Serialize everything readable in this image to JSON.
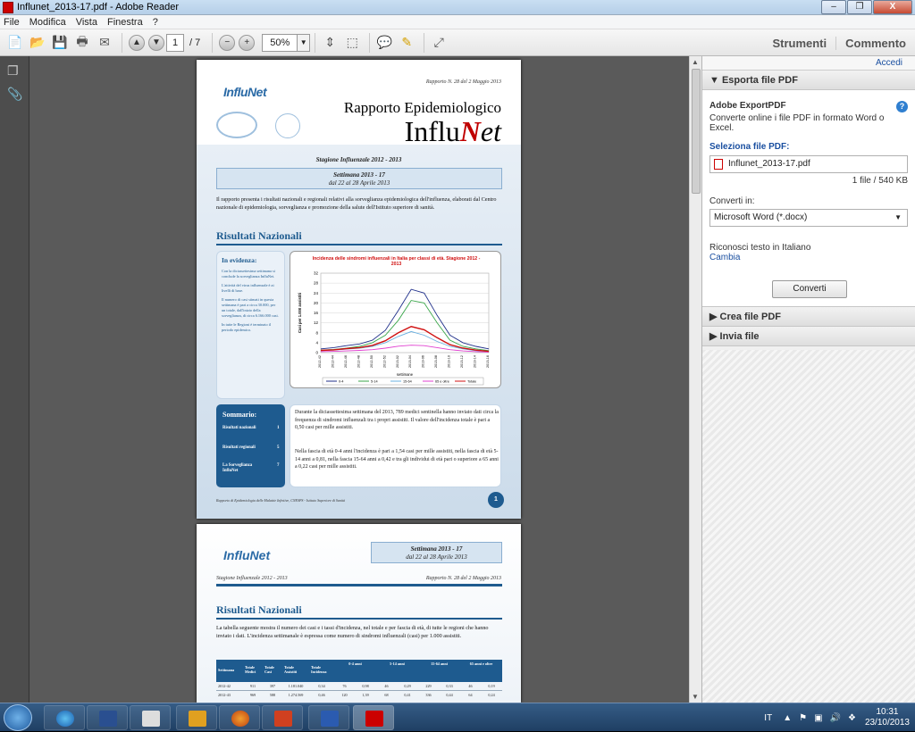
{
  "window": {
    "title": "Influnet_2013-17.pdf - Adobe Reader",
    "buttons": [
      "–",
      "❐",
      "X"
    ]
  },
  "menu": [
    "File",
    "Modifica",
    "Vista",
    "Finestra",
    "?"
  ],
  "toolbar": {
    "page_current": "1",
    "page_total": "/ 7",
    "zoom": "50%",
    "strumenti": "Strumenti",
    "commento": "Commento"
  },
  "pdf_page1": {
    "report_no": "Rapporto N. 28 del 2 Maggio 2013",
    "logo": "InfluNet",
    "title_line1": "Rapporto Epidemiologico",
    "title_influ": "Influ",
    "title_N": "N",
    "title_et": "et",
    "season": "Stagione Influenzale 2012 - 2013",
    "week_line1": "Settimana 2013 - 17",
    "week_line2": "dal 22 al 28 Aprile 2013",
    "intro": "Il rapporto presenta i risultati nazionali e regionali relativi alla sorveglianza epidemiologica dell'influenza, elaborati dal Centro nazionale di epidemiologia, sorveglianza e promozione della salute dell'Istituto superiore di sanità.",
    "section": "Risultati Nazionali",
    "evidenza_title": "In evidenza:",
    "evidenza_items": [
      "Con la diciassettesima settimana si conclude la sorveglianza InfluNet.",
      "L'attività del virus influenzale è ai livelli di base.",
      "Il numero di casi stimati in questa settimana è pari a circa 30.000, per un totale, dall'inizio della sorveglianza, di circa 6.166.000 casi.",
      "In tutte le Regioni è terminato il periodo epidemico."
    ],
    "sommario_title": "Sommario:",
    "sommario_items": [
      {
        "label": "Risultati nazionali",
        "page": "1"
      },
      {
        "label": "Risultati regionali",
        "page": "5"
      },
      {
        "label": "La Sorveglianza InfluNet",
        "page": "7"
      }
    ],
    "body_p1": "Durante la diciassettesima settimana del 2013, 789 medici sentinella hanno inviato dati circa la frequenza di sindromi influenzali tra i propri assistiti. Il valore dell'incidenza totale è pari a 0,50 casi per mille assistiti.",
    "body_p2": "Nella fascia di età 0-4 anni l'incidenza è pari a 1,54 casi per mille assistiti, nella fascia di età 5-14 anni a 0,81, nella fascia 15-64 anni a 0,42 e tra gli individui di età pari o superiore a 65 anni a 0,22 casi per mille assistiti.",
    "footer": "Rapporto di Epidemiologia delle Malattie Infettive, CNESPS - Istituto Superiore di Sanità",
    "page_number": "1"
  },
  "chart_data": {
    "type": "line",
    "title": "Incidenza delle sindromi influenzali in Italia per classi di età. Stagione 2012 - 2013",
    "xlabel": "settimane",
    "ylabel": "Casi per 1.000 assistiti",
    "ylim": [
      0,
      32
    ],
    "yticks": [
      0,
      4,
      8,
      12,
      16,
      20,
      24,
      28,
      32
    ],
    "categories": [
      "2012-42",
      "2012-44",
      "2012-46",
      "2012-48",
      "2012-50",
      "2012-52",
      "2013-02",
      "2013-04",
      "2013-06",
      "2013-08",
      "2013-10",
      "2013-12",
      "2013-14",
      "2013-16"
    ],
    "series": [
      {
        "name": "0-4",
        "color": "#1f2f8a",
        "values": [
          1.5,
          2.0,
          2.8,
          3.5,
          5.0,
          9.0,
          17.0,
          25.5,
          24.0,
          15.0,
          7.0,
          4.0,
          2.5,
          1.5
        ]
      },
      {
        "name": "5-14",
        "color": "#3aa64a",
        "values": [
          1.0,
          1.3,
          1.8,
          2.5,
          4.0,
          7.0,
          13.0,
          21.0,
          20.0,
          12.0,
          5.0,
          2.5,
          1.5,
          0.8
        ]
      },
      {
        "name": "15-64",
        "color": "#6ab0e0",
        "values": [
          0.8,
          1.0,
          1.4,
          1.8,
          2.5,
          4.0,
          6.5,
          8.5,
          7.0,
          4.5,
          2.5,
          1.5,
          0.8,
          0.4
        ]
      },
      {
        "name": "65 e oltre",
        "color": "#e040d0",
        "values": [
          0.4,
          0.5,
          0.7,
          0.9,
          1.2,
          1.8,
          2.6,
          3.0,
          2.8,
          2.0,
          1.2,
          0.7,
          0.4,
          0.2
        ]
      },
      {
        "name": "Totale",
        "color": "#d01010",
        "values": [
          0.9,
          1.1,
          1.6,
          2.0,
          2.9,
          4.8,
          8.0,
          10.5,
          9.2,
          6.0,
          3.2,
          1.8,
          1.0,
          0.5
        ]
      }
    ]
  },
  "pdf_page2": {
    "logo": "InfluNet",
    "week_line1": "Settimana 2013 - 17",
    "week_line2": "dal 22 al 28 Aprile 2013",
    "season": "Stagione Influenzale 2012 - 2013",
    "report_no": "Rapporto N. 28 del 2 Maggio 2013",
    "section": "Risultati Nazionali",
    "intro": "La tabella seguente mostra il numero dei casi e i tassi d'incidenza, nel totale e per fascia di età, di tutte le regioni che hanno inviato i dati. L'incidenza settimanale è espressa come numero di sindromi influenzali (casi) per 1.000 assistiti.",
    "table_headers": [
      "Settimana",
      "Totale Medici",
      "Totale Casi",
      "Totale Assistiti",
      "Totale Incidenza",
      "0-4 anni",
      "5-14 anni",
      "15-64 anni",
      "65 anni e oltre"
    ],
    "table_sub": [
      "Casi",
      "Inc",
      "Casi",
      "Inc",
      "Casi",
      "Inc",
      "Casi",
      "Inc"
    ],
    "rows": [
      [
        "2012-42",
        "911",
        "397",
        "1.181.040",
        "0,34",
        "76",
        "0,98",
        "46",
        "0,29",
        "229",
        "0,33",
        "46",
        "0,19"
      ],
      [
        "2012-43",
        "969",
        "588",
        "1.274.569",
        "0,46",
        "120",
        "1,39",
        "68",
        "0,41",
        "336",
        "0,44",
        "64",
        "0,24"
      ]
    ]
  },
  "right_pane": {
    "accedi": "Accedi",
    "export_header": "Esporta file PDF",
    "export_title": "Adobe ExportPDF",
    "export_desc": "Converte online i file PDF in formato Word o Excel.",
    "select_label": "Seleziona file PDF:",
    "file_name": "Influnet_2013-17.pdf",
    "file_info": "1 file / 540 KB",
    "convert_to_label": "Converti in:",
    "convert_to_value": "Microsoft Word (*.docx)",
    "ocr_text": "Riconosci testo in Italiano",
    "ocr_link": "Cambia",
    "convert_btn": "Converti",
    "create_header": "Crea file PDF",
    "send_header": "Invia file"
  },
  "taskbar": {
    "lang": "IT",
    "time": "10:31",
    "date": "23/10/2013"
  }
}
